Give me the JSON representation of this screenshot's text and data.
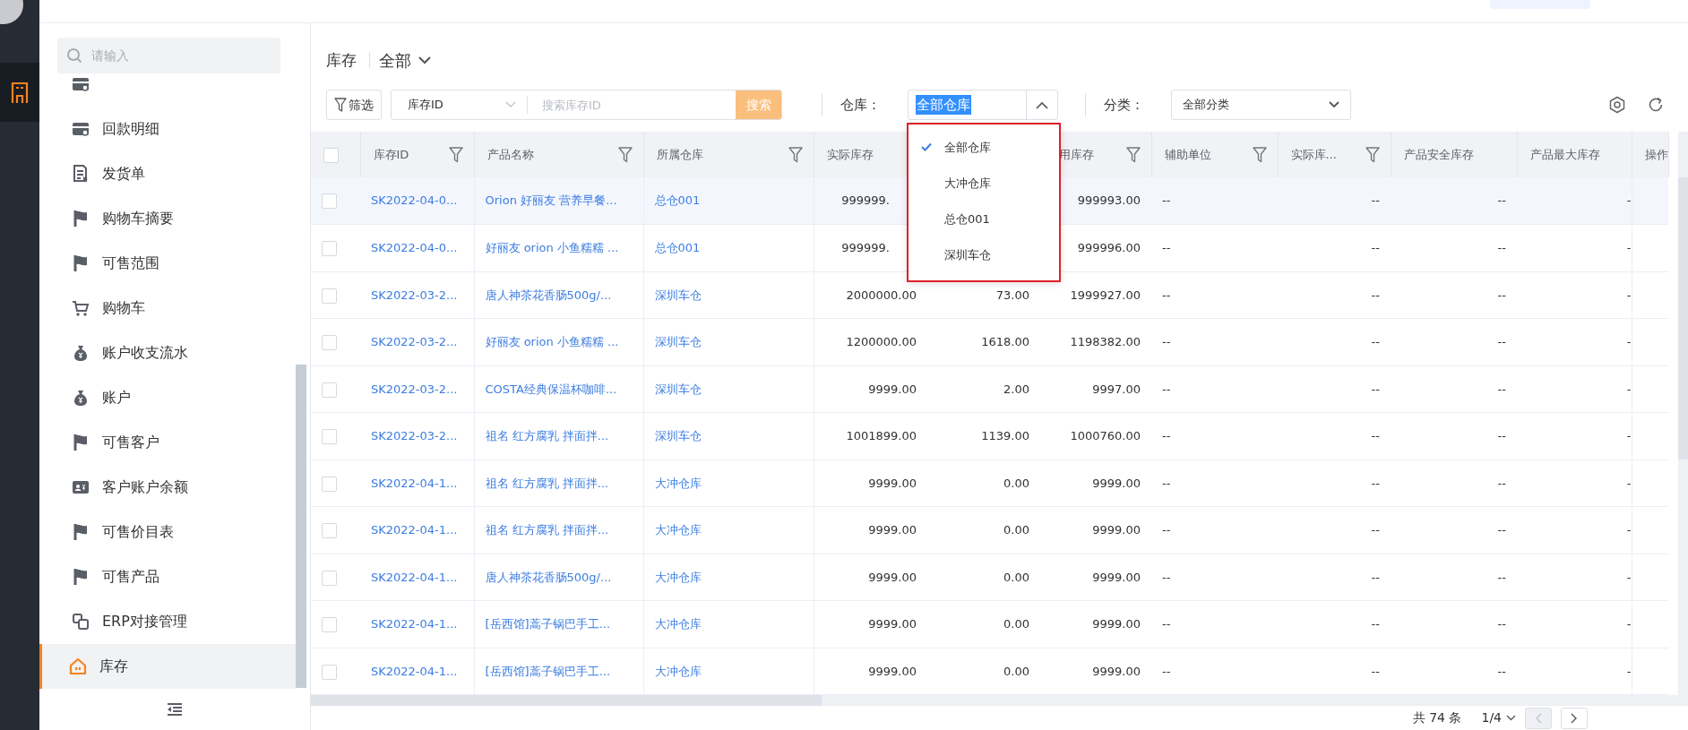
{
  "sidebar": {
    "search": {
      "placeholder": "请输入"
    },
    "items": [
      {
        "selected": false
      },
      {
        "label": "回款明细",
        "selected": false
      },
      {
        "label": "发货单",
        "selected": false
      },
      {
        "label": "购物车摘要",
        "selected": false
      },
      {
        "label": "可售范围",
        "selected": false
      },
      {
        "label": "购物车",
        "selected": false
      },
      {
        "label": "账户收支流水",
        "selected": false
      },
      {
        "label": "账户",
        "selected": false
      },
      {
        "label": "可售客户",
        "selected": false
      },
      {
        "label": "客户账户余额",
        "selected": false
      },
      {
        "label": "可售价目表",
        "selected": false
      },
      {
        "label": "可售产品",
        "selected": false
      },
      {
        "label": "ERP对接管理",
        "selected": false
      },
      {
        "label": "库存",
        "selected": true
      }
    ]
  },
  "page_header": {
    "title": "库存",
    "view": "全部"
  },
  "toolbar": {
    "filter_button": "筛选",
    "search": {
      "field": "库存ID",
      "placeholder": "搜索库存ID",
      "button": "搜索"
    },
    "warehouse": {
      "label": "仓库：",
      "value": "全部仓库",
      "expanded": true,
      "options": [
        {
          "label": "全部仓库",
          "selected": true
        },
        {
          "label": "大冲仓库",
          "selected": false
        },
        {
          "label": "总仓001",
          "selected": false
        },
        {
          "label": "深圳车仓",
          "selected": false
        }
      ]
    },
    "category": {
      "label": "分类：",
      "value": "全部分类"
    }
  },
  "table": {
    "header_checked": false,
    "columns": [
      {
        "label": "库存ID",
        "filter": true
      },
      {
        "label": "产品名称",
        "filter": true
      },
      {
        "label": "所属仓库",
        "filter": true
      },
      {
        "label": "实际库存",
        "filter": false
      },
      {},
      {
        "label": "用库存",
        "filter": true
      },
      {
        "label": "辅助单位",
        "filter": true
      },
      {
        "label": "实际库...",
        "filter": true
      },
      {
        "label": "产品安全库存",
        "filter": false
      },
      {
        "label": "产品最大库存",
        "filter": false
      },
      {
        "label": "操作",
        "filter": false
      }
    ],
    "rows": [
      {
        "checked": false,
        "highlighted": true,
        "cells": [
          "SK2022-04-0...",
          "Orion 好丽友 营养早餐...",
          "总仓001",
          "999999.",
          null,
          "999993.00",
          "--",
          "--",
          "--",
          "-"
        ]
      },
      {
        "checked": false,
        "highlighted": false,
        "cells": [
          "SK2022-04-0...",
          "好丽友 orion 小鱼糯糯 ...",
          "总仓001",
          "999999.",
          null,
          "999996.00",
          "--",
          "--",
          "--",
          "-"
        ]
      },
      {
        "checked": false,
        "highlighted": false,
        "cells": [
          "SK2022-03-2...",
          "唐人神茶花香肠500g/...",
          "深圳车仓",
          "2000000.00",
          "73.00",
          "1999927.00",
          "--",
          "--",
          "--",
          "-"
        ]
      },
      {
        "checked": false,
        "highlighted": false,
        "cells": [
          "SK2022-03-2...",
          "好丽友 orion 小鱼糯糯 ...",
          "深圳车仓",
          "1200000.00",
          "1618.00",
          "1198382.00",
          "--",
          "--",
          "--",
          "-"
        ]
      },
      {
        "checked": false,
        "highlighted": false,
        "cells": [
          "SK2022-03-2...",
          "COSTA经典保温杯咖啡...",
          "深圳车仓",
          "9999.00",
          "2.00",
          "9997.00",
          "--",
          "--",
          "--",
          "-"
        ]
      },
      {
        "checked": false,
        "highlighted": false,
        "cells": [
          "SK2022-03-2...",
          "祖名 红方腐乳 拌面拌...",
          "深圳车仓",
          "1001899.00",
          "1139.00",
          "1000760.00",
          "--",
          "--",
          "--",
          "-"
        ]
      },
      {
        "checked": false,
        "highlighted": false,
        "cells": [
          "SK2022-04-1...",
          "祖名 红方腐乳 拌面拌...",
          "大冲仓库",
          "9999.00",
          "0.00",
          "9999.00",
          "--",
          "--",
          "--",
          "-"
        ]
      },
      {
        "checked": false,
        "highlighted": false,
        "cells": [
          "SK2022-04-1...",
          "祖名 红方腐乳 拌面拌...",
          "大冲仓库",
          "9999.00",
          "0.00",
          "9999.00",
          "--",
          "--",
          "--",
          "-"
        ]
      },
      {
        "checked": false,
        "highlighted": false,
        "cells": [
          "SK2022-04-1...",
          "唐人神茶花香肠500g/...",
          "大冲仓库",
          "9999.00",
          "0.00",
          "9999.00",
          "--",
          "--",
          "--",
          "-"
        ]
      },
      {
        "checked": false,
        "highlighted": false,
        "cells": [
          "SK2022-04-1...",
          "[岳西馆]蒿子锅巴手工...",
          "大冲仓库",
          "9999.00",
          "0.00",
          "9999.00",
          "--",
          "--",
          "--",
          "-"
        ]
      },
      {
        "checked": false,
        "highlighted": false,
        "cells": [
          "SK2022-04-1...",
          "[岳西馆]蒿子锅巴手工...",
          "大冲仓库",
          "9999.00",
          "0.00",
          "9999.00",
          "--",
          "--",
          "--",
          "-"
        ]
      }
    ]
  },
  "pagination": {
    "total": "共 74 条",
    "page": "1/4",
    "prev_disabled": true,
    "next_disabled": false
  }
}
